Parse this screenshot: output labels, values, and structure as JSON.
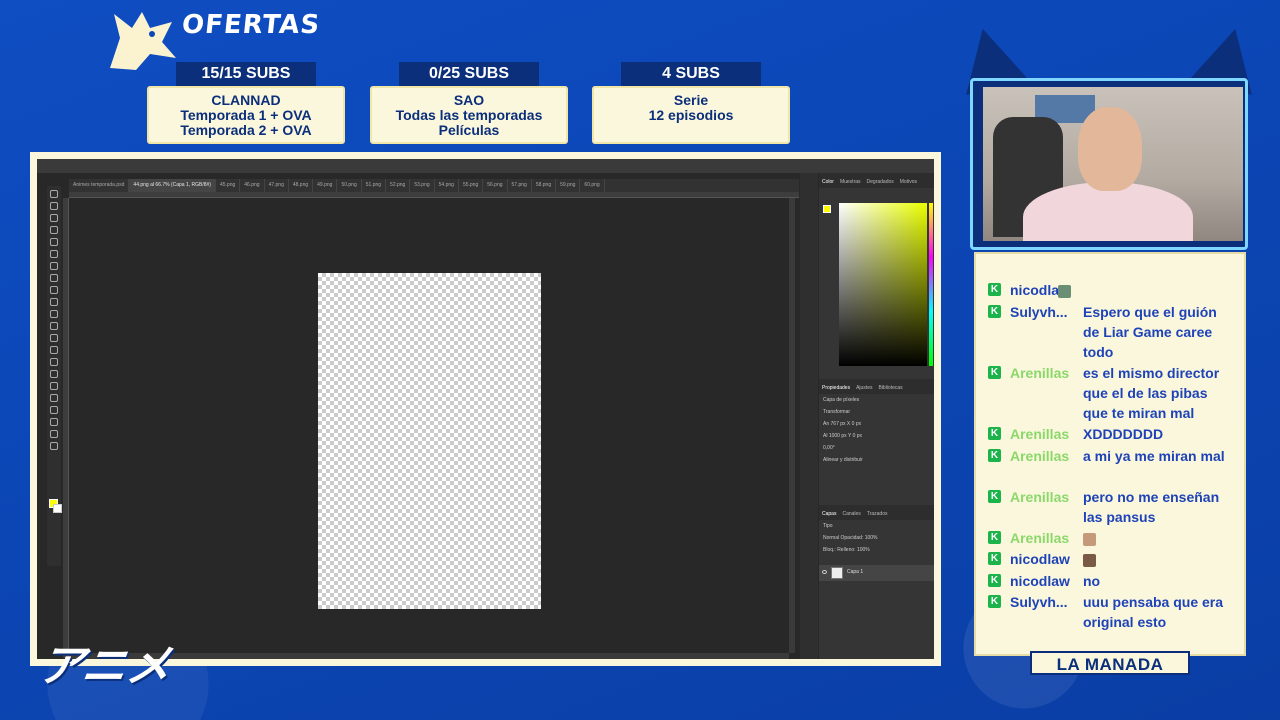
{
  "header": {
    "title": "OFERTAS"
  },
  "offers": [
    {
      "badge": "15/15 SUBS",
      "line1": "CLANNAD",
      "line2": "Temporada 1 + OVA",
      "line3": "Temporada 2 + OVA"
    },
    {
      "badge": "0/25 SUBS",
      "line1": "SAO",
      "line2": "Todas las temporadas",
      "line3": "Películas"
    },
    {
      "badge": "4 SUBS",
      "line1": "Serie",
      "line2": "12 episodios",
      "line3": ""
    }
  ],
  "photoshop": {
    "tabs": [
      "Animes temporada.psd",
      "44.png al 66.7% (Capa 1, RGB/8#)",
      "45.png",
      "46.png",
      "47.png",
      "48.png",
      "49.png",
      "50.png",
      "51.png",
      "52.png",
      "53.png",
      "54.png",
      "55.png",
      "56.png",
      "57.png",
      "58.png",
      "59.png",
      "60.png"
    ],
    "panel_tabs_color": [
      "Color",
      "Muestras",
      "Degradados",
      "Motivos"
    ],
    "panel_tabs_props": [
      "Propiedades",
      "Ajustes",
      "Bibliotecas"
    ],
    "props_layer": "Capa de píxeles",
    "props_transform": "Transformar",
    "props_w": "An  767 px",
    "props_h": "Al  1000 px",
    "props_x": "X  0 px",
    "props_y": "Y  0 px",
    "props_angle": "0,00°",
    "props_align": "Alinear y distribuir",
    "panel_tabs_layers": [
      "Capas",
      "Canales",
      "Trazados"
    ],
    "layers_kind": "Tipo",
    "blend_mode": "Normal",
    "opacity_label": "Opacidad:",
    "opacity_value": "100%",
    "fill_label": "Relleno:",
    "fill_value": "100%",
    "lock_label": "Bloq.:",
    "layer_name": "Capa 1",
    "zoom_readout": "66,67%",
    "colors": {
      "foreground": "#ffff00",
      "background": "#ffffff"
    }
  },
  "brand_logo_text": "アニメ",
  "chat": {
    "messages": [
      {
        "user": "nicodlaw",
        "user_color": "#1e43b8",
        "text": "",
        "emote": true
      },
      {
        "user": "Sulyvh...",
        "user_color": "#1e43b8",
        "text": "Espero que el guión de Liar Game caree todo",
        "emote": false
      },
      {
        "user": "Arenillas",
        "user_color": "#8bd86a",
        "text": "es el mismo director que el de las pibas que te miran mal",
        "emote": false
      },
      {
        "user": "Arenillas",
        "user_color": "#8bd86a",
        "text": "XDDDDDDD",
        "emote": false
      },
      {
        "user": "Arenillas",
        "user_color": "#8bd86a",
        "text": "a mi ya me miran mal",
        "emote": false
      },
      {
        "user": "Arenillas",
        "user_color": "#8bd86a",
        "text": "pero no me enseñan las pansus",
        "emote": false
      },
      {
        "user": "Arenillas",
        "user_color": "#8bd86a",
        "text": "",
        "emote": true
      },
      {
        "user": "nicodlaw",
        "user_color": "#1e43b8",
        "text": "",
        "emote": true
      },
      {
        "user": "nicodlaw",
        "user_color": "#1e43b8",
        "text": "no",
        "emote": false
      },
      {
        "user": "Sulyvh...",
        "user_color": "#1e43b8",
        "text": "uuu pensaba que era original esto",
        "emote": false
      }
    ],
    "footer": "LA MANADA"
  }
}
